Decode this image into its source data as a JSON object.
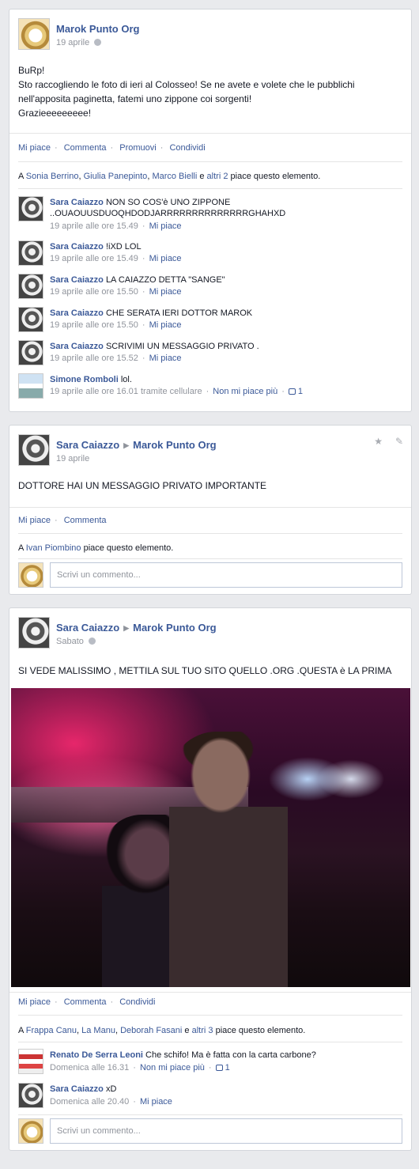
{
  "post1": {
    "author": "Marok Punto Org",
    "date": "19 aprile",
    "lines": [
      "BuRp!",
      "Sto raccogliendo le foto di ieri al Colosseo! Se ne avete e volete che le pubblichi",
      "nell'apposita paginetta, fatemi uno zippone coi sorgenti!",
      "Grazieeeeeeeee!"
    ],
    "actions": [
      "Mi piace",
      "Commenta",
      "Promuovi",
      "Condividi"
    ],
    "likes": {
      "prefix": "A",
      "names": [
        "Sonia Berrino",
        "Giulia Panepinto",
        "Marco Bielli"
      ],
      "conj": "e",
      "others": "altri 2",
      "suffix": "piace questo elemento."
    },
    "comments": [
      {
        "name": "Sara Caiazzo",
        "text": "NON SO COS'è UNO ZIPPONE ..OUAOUUSDUOQHDODJARRRRRRRRRRRRRRGHAHXD",
        "time": "19 aprile alle ore 15.49",
        "action": "Mi piace"
      },
      {
        "name": "Sara Caiazzo",
        "text": "!iXD LOL",
        "time": "19 aprile alle ore 15.49",
        "action": "Mi piace"
      },
      {
        "name": "Sara Caiazzo",
        "text": "LA CAIAZZO DETTA \"SANGE\"",
        "time": "19 aprile alle ore 15.50",
        "action": "Mi piace"
      },
      {
        "name": "Sara Caiazzo",
        "text": "CHE SERATA IERI DOTTOR MAROK",
        "time": "19 aprile alle ore 15.50",
        "action": "Mi piace"
      },
      {
        "name": "Sara Caiazzo",
        "text": "SCRIVIMI UN MESSAGGIO PRIVATO .",
        "time": "19 aprile alle ore 15.52",
        "action": "Mi piace"
      },
      {
        "name": "Simone Romboli",
        "text": "lol.",
        "time": "19 aprile alle ore 16.01 tramite cellulare",
        "action": "Non mi piace più",
        "like_count": "1"
      }
    ]
  },
  "post2": {
    "author": "Sara Caiazzo",
    "target": "Marok Punto Org",
    "date": "19 aprile",
    "text": "DOTTORE HAI UN MESSAGGIO PRIVATO IMPORTANTE",
    "actions": [
      "Mi piace",
      "Commenta"
    ],
    "likes": {
      "prefix": "A",
      "name": "Ivan Piombino",
      "suffix": "piace questo elemento."
    },
    "comment_placeholder": "Scrivi un commento..."
  },
  "post3": {
    "author": "Sara Caiazzo",
    "target": "Marok Punto Org",
    "date": "Sabato",
    "text": "SI VEDE MALISSIMO , METTILA SUL TUO SITO QUELLO .ORG .QUESTA è LA PRIMA",
    "actions": [
      "Mi piace",
      "Commenta",
      "Condividi"
    ],
    "likes": {
      "prefix": "A",
      "names": [
        "Frappa Canu",
        "La Manu",
        "Deborah Fasani"
      ],
      "conj": "e",
      "others": "altri 3",
      "suffix": "piace questo elemento."
    },
    "comments": [
      {
        "name": "Renato De Serra Leoni",
        "text": "Che schifo! Ma è fatta con la carta carbone?",
        "time": "Domenica alle 16.31",
        "action": "Non mi piace più",
        "like_count": "1"
      },
      {
        "name": "Sara Caiazzo",
        "text": "xD",
        "time": "Domenica alle 20.40",
        "action": "Mi piace"
      }
    ],
    "comment_placeholder": "Scrivi un commento..."
  },
  "icons": [
    "globe-icon",
    "star-icon",
    "pencil-icon",
    "triangle-arrow-icon",
    "thumbs-up-icon"
  ],
  "colors": {
    "link": "#3b5998",
    "background": "#e9eaed",
    "meta": "#90949c"
  }
}
